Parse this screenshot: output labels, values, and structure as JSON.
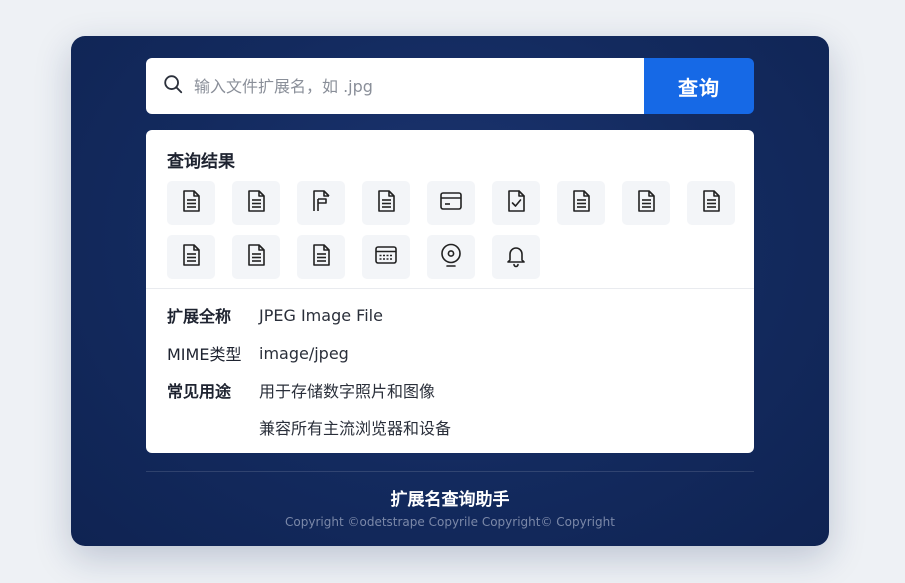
{
  "search": {
    "placeholder": "输入文件扩展名，如 .jpg",
    "value": "",
    "button_label": "查询",
    "icon": "search-icon"
  },
  "results": {
    "title": "查询结果",
    "icons": [
      "document-icon",
      "document-icon",
      "file-flag-icon",
      "document-icon",
      "window-card-icon",
      "document-check-icon",
      "document-icon",
      "document-icon",
      "document-icon",
      "document-icon",
      "document-icon",
      "document-icon",
      "window-list-icon",
      "disc-icon",
      "bell-icon"
    ],
    "details": [
      {
        "label": "扩展全称",
        "value": "JPEG Image File"
      },
      {
        "label": "MIME类型",
        "value": "image/jpeg"
      },
      {
        "label": "常见用途",
        "value": "用于存储数字照片和图像"
      },
      {
        "label": "",
        "value": "兼容所有主流浏览器和设备"
      }
    ]
  },
  "footer": {
    "title": "扩展名查询助手",
    "copyright": "Copyright ©odetstrape Copyrile Copyright© Copyright"
  },
  "colors": {
    "card_bg": "#142a5c",
    "accent": "#1669e6",
    "panel_bg": "#ffffff"
  }
}
